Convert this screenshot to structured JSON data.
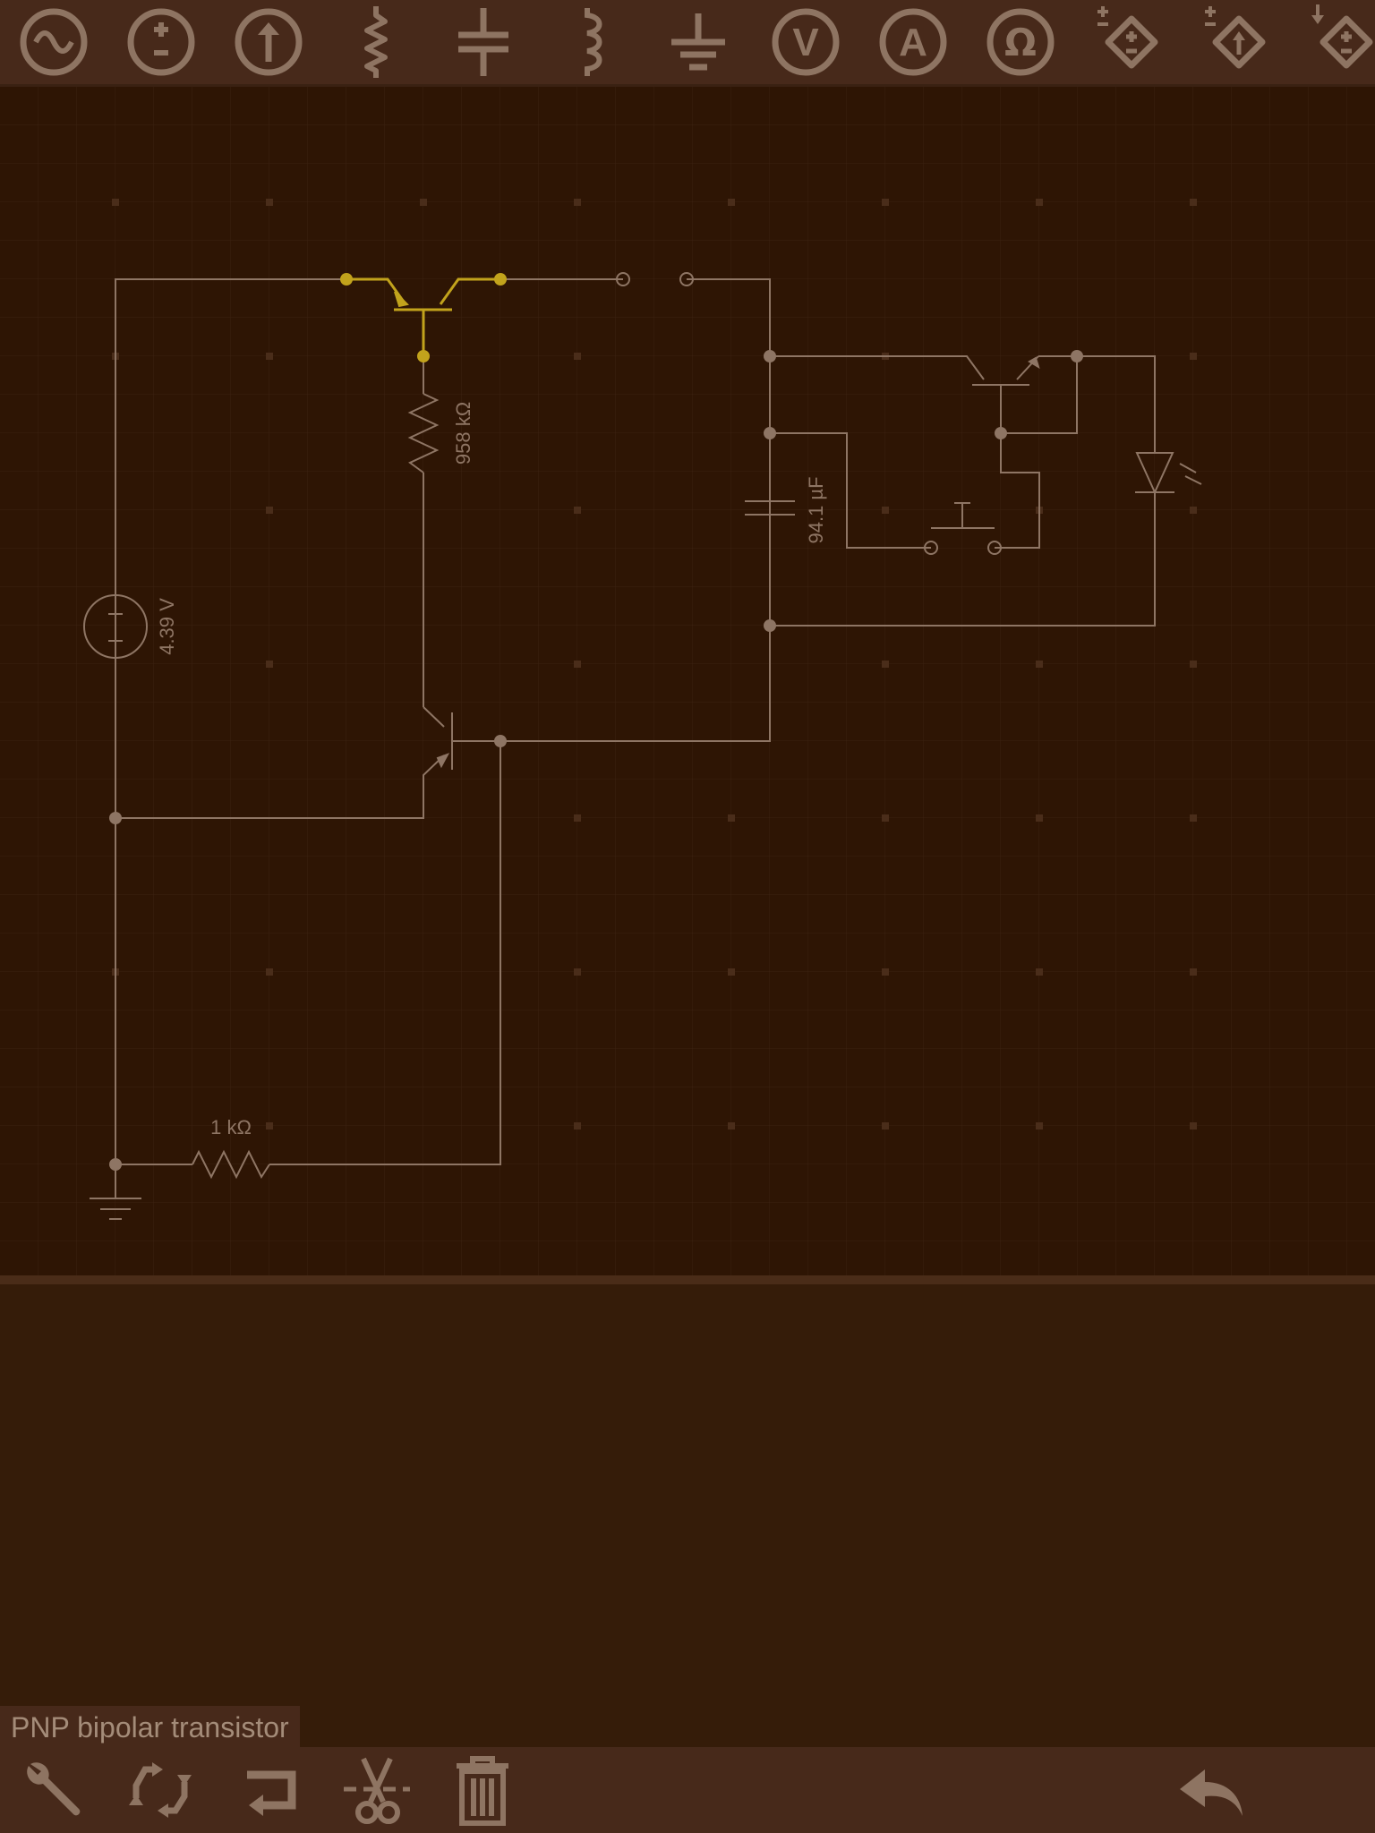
{
  "toolbar": {
    "tools": [
      {
        "name": "ac-source-icon"
      },
      {
        "name": "dc-voltage-source-icon"
      },
      {
        "name": "current-source-icon"
      },
      {
        "name": "resistor-icon"
      },
      {
        "name": "capacitor-icon"
      },
      {
        "name": "inductor-icon"
      },
      {
        "name": "ground-icon"
      },
      {
        "name": "voltmeter-icon",
        "glyph": "V"
      },
      {
        "name": "ammeter-icon",
        "glyph": "A"
      },
      {
        "name": "ohmmeter-icon",
        "glyph": "Ω"
      },
      {
        "name": "controlled-voltage-source-icon"
      },
      {
        "name": "controlled-current-source-icon"
      },
      {
        "name": "controlled-source-alt-icon"
      }
    ]
  },
  "circuit": {
    "labels": {
      "resistor_top": "958 kΩ",
      "capacitor": "94.1 µF",
      "voltage_source": "4.39 V",
      "resistor_bottom": "1 kΩ"
    },
    "selected_component": "PNP bipolar transistor"
  },
  "bottombar": {
    "tools": [
      "wrench-icon",
      "rotate-icon",
      "flip-icon",
      "cut-icon",
      "trash-icon"
    ],
    "undo": "undo-icon"
  },
  "colors": {
    "background": "#2e1504",
    "toolbar": "#47291a",
    "wire": "#8e7564",
    "selected": "#c2a31c",
    "icon": "#8e7462"
  }
}
